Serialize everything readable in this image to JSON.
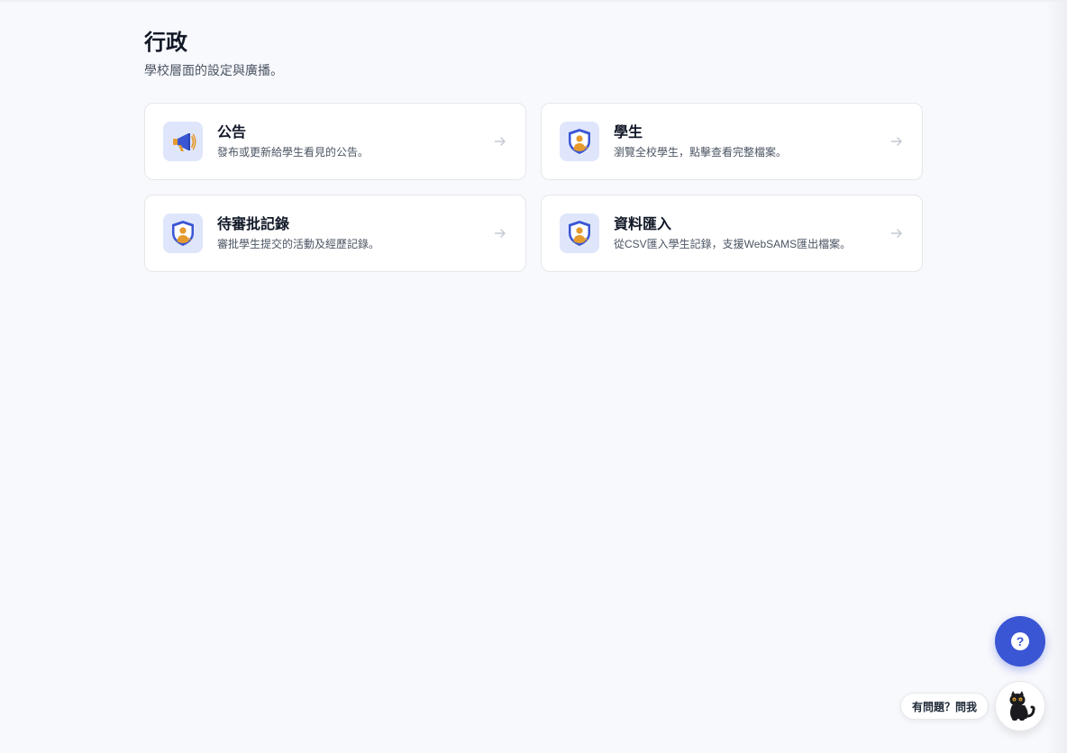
{
  "header": {
    "title": "行政",
    "subtitle": "學校層面的設定與廣播。"
  },
  "cards": [
    {
      "title": "公告",
      "description": "發布或更新給學生看見的公告。",
      "icon": "megaphone-icon"
    },
    {
      "title": "學生",
      "description": "瀏覽全校學生，點擊查看完整檔案。",
      "icon": "shield-student-icon"
    },
    {
      "title": "待審批記錄",
      "description": "審批學生提交的活動及經歷記錄。",
      "icon": "shield-student-icon"
    },
    {
      "title": "資料匯入",
      "description": "從CSV匯入學生記錄，支援WebSAMS匯出檔案。",
      "icon": "shield-student-icon"
    }
  ],
  "assistant": {
    "help_icon_label": "?",
    "ask_label": "有問題？問我",
    "icon": "black-cat-icon"
  },
  "colors": {
    "accent": "#3b56d4",
    "icon_bg": "#dfe6fb",
    "background": "#f8f9fc"
  }
}
